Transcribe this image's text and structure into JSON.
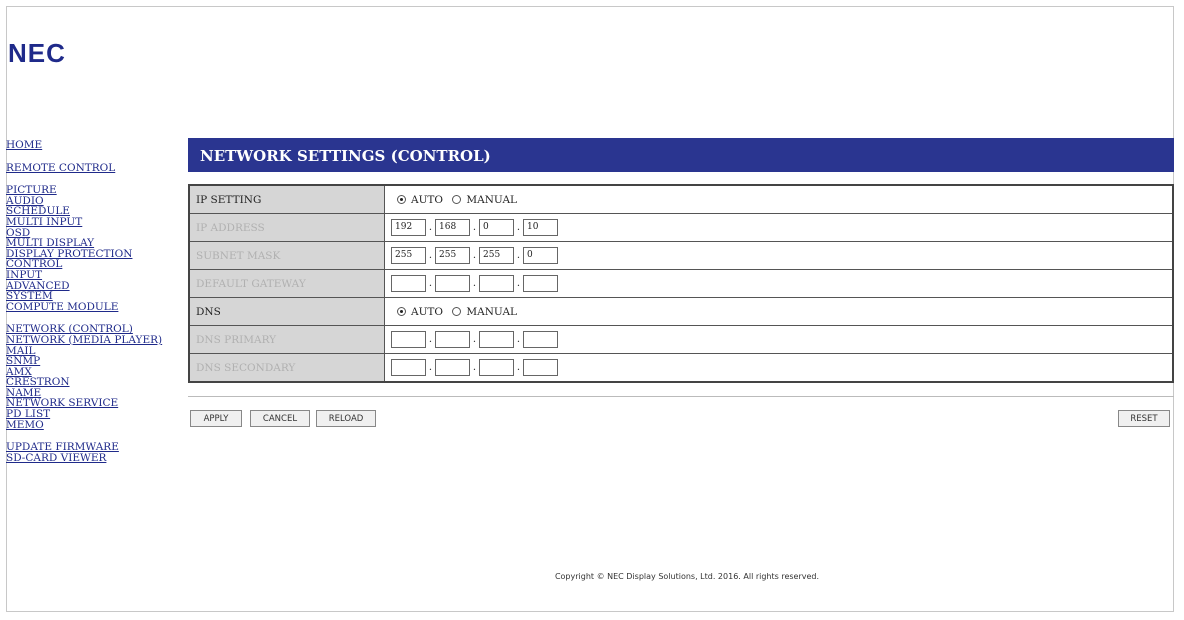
{
  "brand": {
    "logo_text": "NEC"
  },
  "nav": {
    "home": "HOME",
    "remote_control": "REMOTE CONTROL",
    "picture": "PICTURE",
    "audio": "AUDIO",
    "schedule": "SCHEDULE",
    "multi_input": "MULTI INPUT",
    "osd": "OSD",
    "multi_display": "MULTI DISPLAY",
    "display_protection": "DISPLAY PROTECTION",
    "control": "CONTROL",
    "input": "INPUT",
    "advanced": "ADVANCED",
    "system": "SYSTEM",
    "compute_module": "COMPUTE MODULE",
    "network_control": "NETWORK (CONTROL)",
    "network_media_player": "NETWORK (MEDIA PLAYER)",
    "mail": "MAIL",
    "snmp": "SNMP",
    "amx": "AMX",
    "crestron": "CRESTRON",
    "name": "NAME",
    "network_service": "NETWORK SERVICE",
    "pd_list": "PD LIST",
    "memo": "MEMO",
    "update_firmware": "UPDATE FIRMWARE",
    "sd_card_viewer": "SD-CARD VIEWER"
  },
  "page": {
    "title": "NETWORK SETTINGS (CONTROL)"
  },
  "ip_setting": {
    "label": "IP SETTING",
    "auto": "AUTO",
    "manual": "MANUAL",
    "selected": "AUTO"
  },
  "ip_address": {
    "label": "IP ADDRESS",
    "octets": [
      "192",
      "168",
      "0",
      "10"
    ]
  },
  "subnet_mask": {
    "label": "SUBNET MASK",
    "octets": [
      "255",
      "255",
      "255",
      "0"
    ]
  },
  "default_gateway": {
    "label": "DEFAULT GATEWAY",
    "octets": [
      "",
      "",
      "",
      ""
    ]
  },
  "dns": {
    "label": "DNS",
    "auto": "AUTO",
    "manual": "MANUAL",
    "selected": "AUTO"
  },
  "dns_primary": {
    "label": "DNS PRIMARY",
    "octets": [
      "",
      "",
      "",
      ""
    ]
  },
  "dns_secondary": {
    "label": "DNS SECONDARY",
    "octets": [
      "",
      "",
      "",
      ""
    ]
  },
  "buttons": {
    "apply": "APPLY",
    "cancel": "CANCEL",
    "reload": "RELOAD",
    "reset": "RESET"
  },
  "footer": {
    "copyright": "Copyright © NEC Display Solutions, Ltd. 2016. All rights reserved."
  },
  "colors": {
    "header_bar": "#2a3590",
    "link": "#1f2a8a",
    "label_bg": "#d6d6d6"
  }
}
